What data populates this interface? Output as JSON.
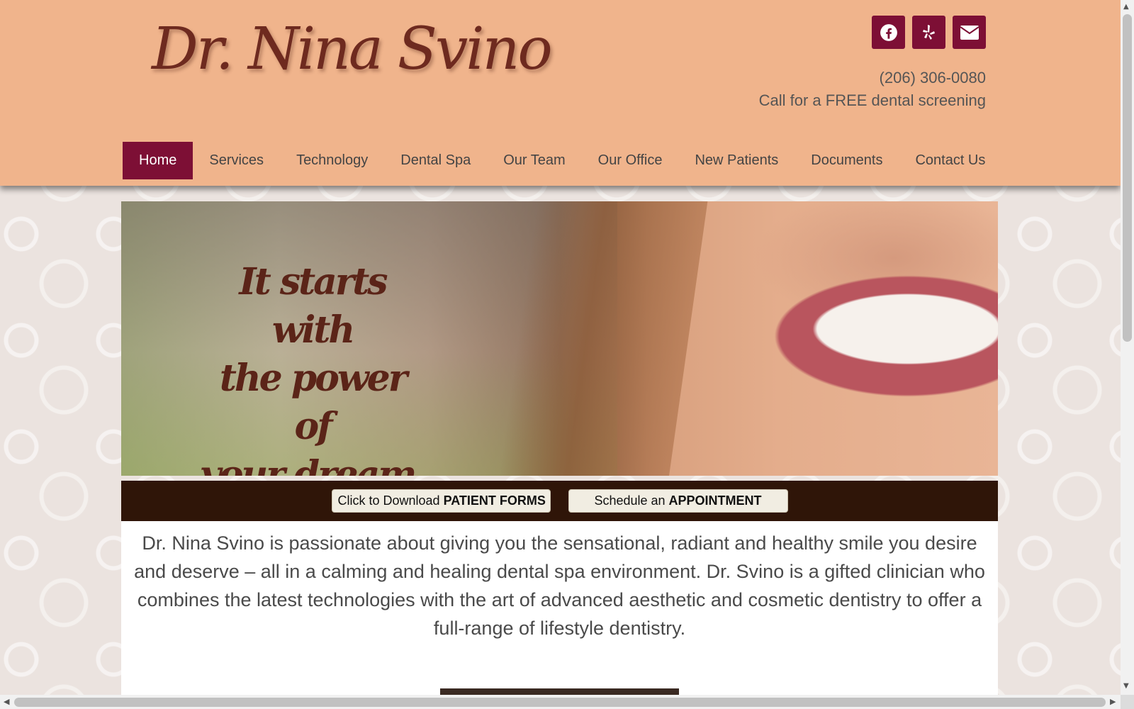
{
  "header": {
    "logo_text": "Dr. Nina Svino",
    "phone": "(206) 306-0080",
    "tagline": "Call for a FREE dental screening",
    "social": [
      {
        "icon": "facebook-icon"
      },
      {
        "icon": "yelp-icon"
      },
      {
        "icon": "envelope-icon"
      }
    ]
  },
  "nav": {
    "items": [
      {
        "label": "Home",
        "active": true
      },
      {
        "label": "Services"
      },
      {
        "label": "Technology"
      },
      {
        "label": "Dental Spa"
      },
      {
        "label": "Our Team"
      },
      {
        "label": "Our Office"
      },
      {
        "label": "New Patients"
      },
      {
        "label": "Documents"
      },
      {
        "label": "Contact Us"
      }
    ]
  },
  "hero": {
    "line1": "It starts with",
    "line2": "the power of",
    "line3": "your dream."
  },
  "cta": {
    "forms_prefix": "Click to Download ",
    "forms_bold": "PATIENT FORMS",
    "appt_prefix": "Schedule an ",
    "appt_bold": "APPOINTMENT"
  },
  "content": {
    "intro": "Dr. Nina Svino is passionate about giving you the sensational, radiant and healthy smile you desire and deserve – all in a calming and healing dental spa environment. Dr. Svino is a gifted clinician who combines the latest technologies with the art of advanced aesthetic and cosmetic dentistry to offer a full-range of lifestyle dentistry."
  },
  "colors": {
    "header_bg": "#f0b48c",
    "accent": "#7d0f35",
    "cta_bar": "#2f1508"
  }
}
